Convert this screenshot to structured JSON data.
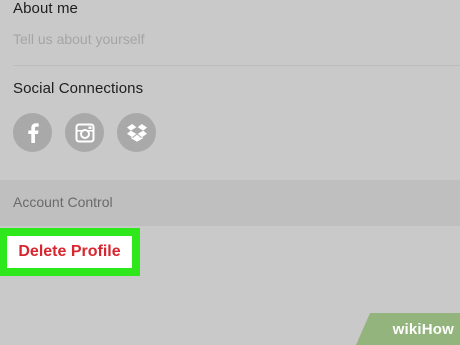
{
  "about": {
    "title": "About me",
    "placeholder": "Tell us about yourself"
  },
  "social": {
    "title": "Social Connections",
    "icons": [
      "facebook-icon",
      "instagram-icon",
      "dropbox-icon"
    ]
  },
  "account": {
    "header": "Account Control",
    "delete_label": "Delete Profile"
  },
  "watermark": {
    "text": "wikiHow"
  },
  "colors": {
    "background": "#c9c9c9",
    "header_band": "#bfbfbf",
    "highlight": "#2fe81c",
    "delete_red": "#d8262e",
    "icon_circle": "#a9a9a9"
  }
}
